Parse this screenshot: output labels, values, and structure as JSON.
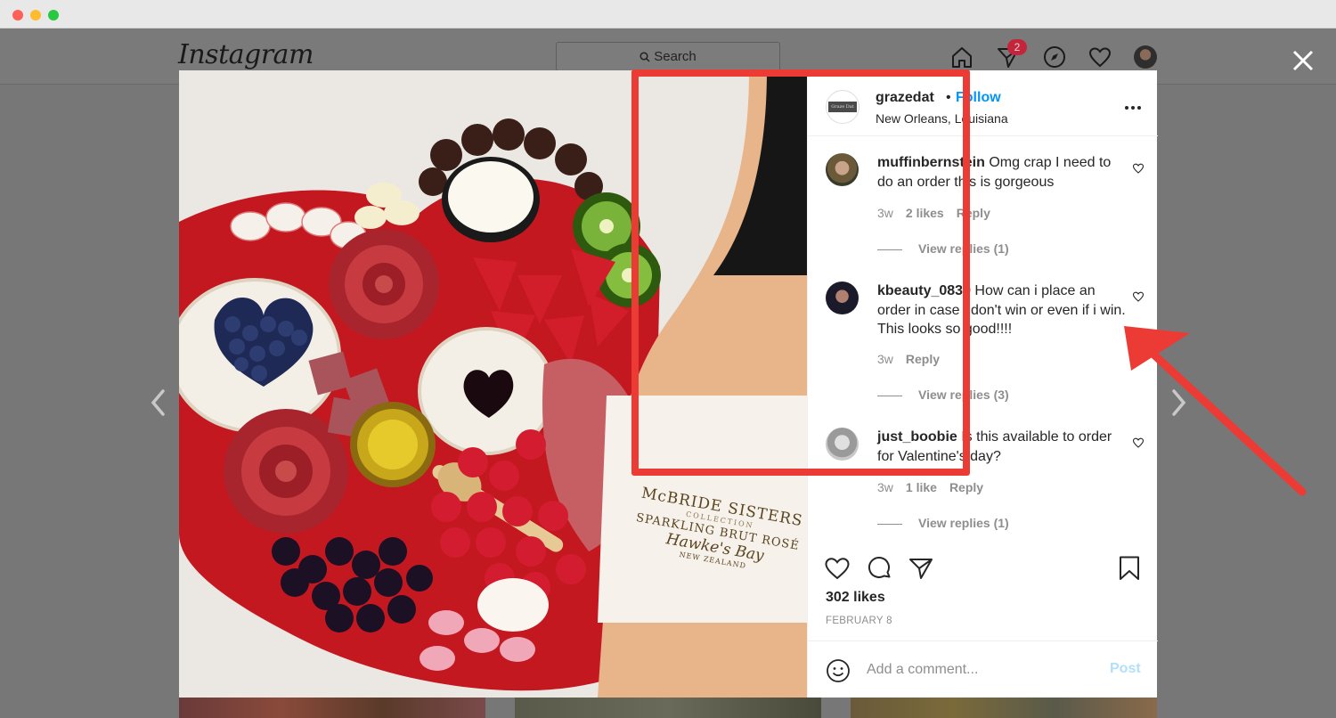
{
  "app": {
    "logo_text": "Instagram",
    "search_placeholder": "Search",
    "notifications_count": "2"
  },
  "post": {
    "username": "grazedat",
    "separator": "•",
    "follow_label": "Follow",
    "location": "New Orleans, Louisiana",
    "avatar_text": "Graze Dat",
    "photo_labels": {
      "brand": "McBRIDE SISTERS",
      "collection": "COLLECTION",
      "variety": "SPARKLING BRUT ROSÉ",
      "region": "Hawke's Bay",
      "country": "NEW ZEALAND"
    },
    "likes": "302 likes",
    "date": "FEBRUARY 8"
  },
  "comments": [
    {
      "username": "muffinbernstein",
      "text": "Omg crap I need to do an order this is gorgeous",
      "age": "3w",
      "likes": "2 likes",
      "reply_label": "Reply",
      "view_replies": "View replies (1)"
    },
    {
      "username": "kbeauty_0830",
      "text": "How can i place an order in case i don't win or even if i win. This looks so good!!!!",
      "age": "3w",
      "likes": "",
      "reply_label": "Reply",
      "view_replies": "View replies (3)"
    },
    {
      "username": "just_boobie",
      "text": "Is this available to order for Valentine's day?",
      "age": "3w",
      "likes": "1 like",
      "reply_label": "Reply",
      "view_replies": "View replies (1)"
    }
  ],
  "composer": {
    "placeholder": "Add a comment...",
    "post_label": "Post"
  },
  "colors": {
    "accent": "#0095f6",
    "post_disabled": "#b2dffc",
    "annotation": "#ec3b34",
    "badge": "#c5253a"
  }
}
